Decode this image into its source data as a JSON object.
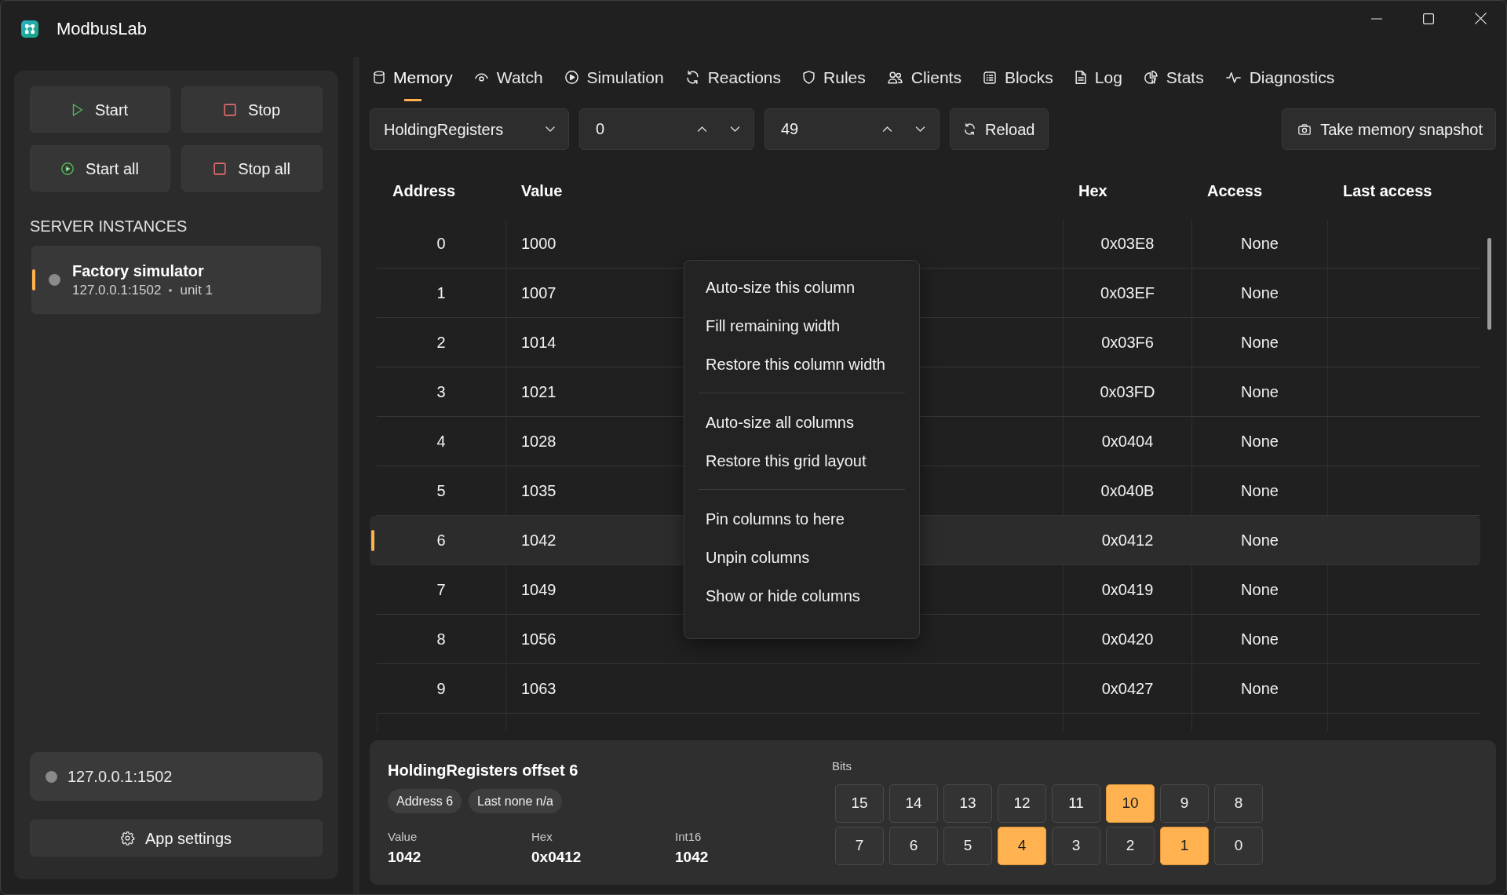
{
  "window": {
    "title": "ModbusLab"
  },
  "sidebar": {
    "buttons": [
      {
        "label": "Start"
      },
      {
        "label": "Stop"
      },
      {
        "label": "Start all"
      },
      {
        "label": "Stop all"
      }
    ],
    "section_title": "SERVER INSTANCES",
    "instances": [
      {
        "name": "Factory simulator",
        "endpoint": "127.0.0.1:1502",
        "unit": "unit 1",
        "selected": true,
        "running": false
      }
    ],
    "connection": {
      "label": "127.0.0.1:1502",
      "connected": false
    },
    "settings_button": {
      "label": "App settings"
    }
  },
  "tabs": [
    {
      "label": "Memory",
      "selected": true
    },
    {
      "label": "Watch",
      "selected": false
    },
    {
      "label": "Simulation",
      "selected": false
    },
    {
      "label": "Reactions",
      "selected": false
    },
    {
      "label": "Rules",
      "selected": false
    },
    {
      "label": "Clients",
      "selected": false
    },
    {
      "label": "Blocks",
      "selected": false
    },
    {
      "label": "Log",
      "selected": false
    },
    {
      "label": "Stats",
      "selected": false
    },
    {
      "label": "Diagnostics",
      "selected": false
    }
  ],
  "toolbar": {
    "area": {
      "value": "HoldingRegisters"
    },
    "range_start": {
      "value": "0"
    },
    "range_end": {
      "value": "49"
    },
    "reload_button": "Reload",
    "snapshot_button": "Take memory snapshot"
  },
  "table": {
    "columns": [
      "Address",
      "Value",
      "Hex",
      "Access",
      "Last access"
    ],
    "rows": [
      {
        "address": "0",
        "value": "1000",
        "hex": "0x03E8",
        "access": "None",
        "selected": false
      },
      {
        "address": "1",
        "value": "1007",
        "hex": "0x03EF",
        "access": "None",
        "selected": false
      },
      {
        "address": "2",
        "value": "1014",
        "hex": "0x03F6",
        "access": "None",
        "selected": false
      },
      {
        "address": "3",
        "value": "1021",
        "hex": "0x03FD",
        "access": "None",
        "selected": false
      },
      {
        "address": "4",
        "value": "1028",
        "hex": "0x0404",
        "access": "None",
        "selected": false
      },
      {
        "address": "5",
        "value": "1035",
        "hex": "0x040B",
        "access": "None",
        "selected": false
      },
      {
        "address": "6",
        "value": "1042",
        "hex": "0x0412",
        "access": "None",
        "selected": true
      },
      {
        "address": "7",
        "value": "1049",
        "hex": "0x0419",
        "access": "None",
        "selected": false
      },
      {
        "address": "8",
        "value": "1056",
        "hex": "0x0420",
        "access": "None",
        "selected": false
      },
      {
        "address": "9",
        "value": "1063",
        "hex": "0x0427",
        "access": "None",
        "selected": false
      }
    ]
  },
  "context_menu": {
    "groups": [
      {
        "items": [
          "Auto-size this column",
          "Fill remaining width",
          "Restore this column width"
        ]
      },
      {
        "items": [
          "Auto-size all columns",
          "Restore this grid layout"
        ]
      },
      {
        "items": [
          "Pin columns to here",
          "Unpin columns",
          "Show or hide columns"
        ]
      }
    ]
  },
  "details": {
    "title": "HoldingRegisters offset 6",
    "chips": [
      "Address 6",
      "Last none n/a"
    ],
    "fields": [
      {
        "label": "Value",
        "value": "1042"
      },
      {
        "label": "Hex",
        "value": "0x0412"
      },
      {
        "label": "Int16",
        "value": "1042"
      }
    ],
    "bits_label": "Bits",
    "bits": [
      {
        "label": "15",
        "on": false
      },
      {
        "label": "14",
        "on": false
      },
      {
        "label": "13",
        "on": false
      },
      {
        "label": "12",
        "on": false
      },
      {
        "label": "11",
        "on": false
      },
      {
        "label": "10",
        "on": true
      },
      {
        "label": "9",
        "on": false
      },
      {
        "label": "8",
        "on": false
      },
      {
        "label": "7",
        "on": false
      },
      {
        "label": "6",
        "on": false
      },
      {
        "label": "5",
        "on": false
      },
      {
        "label": "4",
        "on": true
      },
      {
        "label": "3",
        "on": false
      },
      {
        "label": "2",
        "on": false
      },
      {
        "label": "1",
        "on": true
      },
      {
        "label": "0",
        "on": false
      }
    ]
  }
}
